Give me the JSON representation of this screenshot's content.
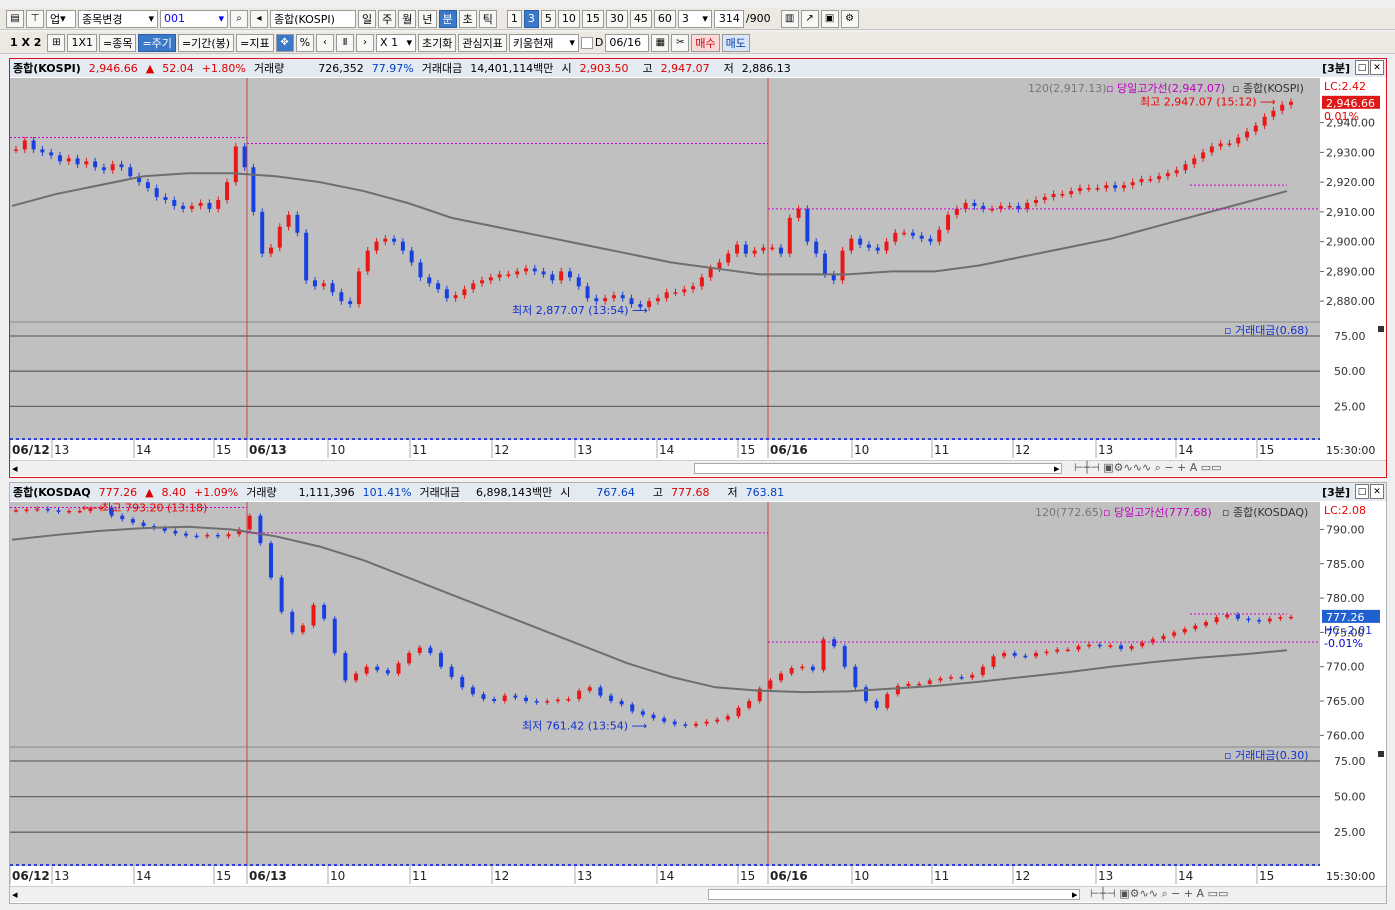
{
  "toolbar1": {
    "market": "업",
    "stock_change": "종목변경",
    "code": "001",
    "search_name": "종합(KOSPI)",
    "periods": [
      "일",
      "주",
      "월",
      "년",
      "분",
      "초",
      "틱"
    ],
    "active_period": "분",
    "intervals": [
      "1",
      "3",
      "5",
      "10",
      "15",
      "30",
      "45",
      "60"
    ],
    "active_interval": "3",
    "count_select": "3",
    "count": "314",
    "count_max": "/900"
  },
  "toolbar2": {
    "layout": "1 X 2",
    "btn_1x1": "1X1",
    "btn_stock": "=종목",
    "btn_period": "=주기",
    "btn_range": "=기간(봉)",
    "btn_indicator": "=지표",
    "btn_pct": "%",
    "zoom": "X 1",
    "btn_reset": "초기화",
    "btn_watch": "관심지표",
    "btn_kiwoom": "키움현재",
    "date": "06/16",
    "btn_buy": "매수",
    "btn_sell": "매도"
  },
  "panes": [
    {
      "title": "종합(KOSPI)",
      "price": "2,946.66",
      "arrow": "▲",
      "change": "52.04",
      "change_pct": "+1.80%",
      "vol_label": "거래량",
      "volume": "726,352",
      "vol_ratio": "77.97%",
      "amt_label": "거래대금",
      "amount": "14,401,114백만",
      "open_label": "시",
      "open": "2,903.50",
      "high_label": "고",
      "high": "2,947.07",
      "low_label": "저",
      "low": "2,886.13",
      "period_badge": "[3분]",
      "legend_ma": "120(2,917.13)",
      "legend_high": "당일고가선(2,947.07)",
      "legend_name": "종합(KOSPI)",
      "lc": "LC:2.42",
      "last_tag": "2,946.66",
      "hc": "0.01%",
      "max_label": "최고 2,947.07 (15:12)",
      "min_label": "최저 2,877.07 (13:54)",
      "sub_legend": "거래대금(0.68)",
      "time_label": "15:30:00"
    },
    {
      "title": "종합(KOSDAQ",
      "price": "777.26",
      "arrow": "▲",
      "change": "8.40",
      "change_pct": "+1.09%",
      "vol_label": "거래량",
      "volume": "1,111,396",
      "vol_ratio": "101.41%",
      "amt_label": "거래대금",
      "amount": "6,898,143백만",
      "open_label": "시",
      "open": "767.64",
      "high_label": "고",
      "high": "777.68",
      "low_label": "저",
      "low": "763.81",
      "period_badge": "[3분]",
      "legend_ma": "120(772.65)",
      "legend_high": "당일고가선(777.68)",
      "legend_name": "종합(KOSDAQ)",
      "lc": "LC:2.08",
      "last_tag": "777.26",
      "hc": "HC:-2.01",
      "hc2": "-0.01%",
      "max_label": "최고 793.20 (13:18)",
      "min_label": "최저 761.42 (13:54)",
      "sub_legend": "거래대금(0.30)",
      "time_label": "15:30:00"
    }
  ],
  "chart_data": [
    {
      "type": "candlestick",
      "series_name": "종합(KOSPI)",
      "x_ticks": [
        "06/12",
        "13",
        "14",
        "15",
        "06/13",
        "10",
        "11",
        "12",
        "13",
        "14",
        "15",
        "06/16",
        "10",
        "11",
        "12",
        "13",
        "14",
        "15"
      ],
      "y_ticks": [
        2940,
        2930,
        2920,
        2910,
        2900,
        2890,
        2880
      ],
      "ylim": [
        2873,
        2955
      ],
      "close_path": [
        2931,
        2934,
        2931,
        2930,
        2929,
        2927,
        2928,
        2926,
        2927,
        2925,
        2924,
        2926,
        2925,
        2922,
        2920,
        2918,
        2915,
        2914,
        2912,
        2911,
        2912,
        2913,
        2911,
        2914,
        2920,
        2932,
        2925,
        2910,
        2896,
        2898,
        2905,
        2909,
        2903,
        2887,
        2885,
        2886,
        2883,
        2880,
        2879,
        2890,
        2897,
        2900,
        2901,
        2900,
        2897,
        2893,
        2888,
        2886,
        2884,
        2881,
        2882,
        2884,
        2886,
        2887,
        2888,
        2889,
        2889,
        2890,
        2891,
        2890,
        2889,
        2887,
        2890,
        2888,
        2885,
        2881,
        2880,
        2881,
        2882,
        2881,
        2879,
        2878,
        2880,
        2881,
        2883,
        2883,
        2884,
        2885,
        2888,
        2891,
        2893,
        2896,
        2899,
        2896,
        2897,
        2898,
        2898,
        2896,
        2908,
        2911,
        2900,
        2896,
        2889,
        2887,
        2897,
        2901,
        2899,
        2898,
        2897,
        2900,
        2903,
        2903,
        2902,
        2901,
        2900,
        2904,
        2909,
        2911,
        2913,
        2912,
        2911,
        2911,
        2912,
        2912,
        2911,
        2913,
        2914,
        2915,
        2916,
        2916,
        2917,
        2918,
        2918,
        2918,
        2919,
        2918,
        2919,
        2920,
        2921,
        2921,
        2922,
        2923,
        2924,
        2926,
        2928,
        2930,
        2932,
        2933,
        2933,
        2935,
        2937,
        2939,
        2942,
        2944,
        2946,
        2947
      ],
      "ma120": [
        2912,
        2916,
        2919,
        2922,
        2923,
        2923,
        2922,
        2920,
        2917,
        2913,
        2908,
        2905,
        2902,
        2899,
        2896,
        2893,
        2891,
        2889,
        2889,
        2889,
        2890,
        2890,
        2892,
        2895,
        2898,
        2901,
        2905,
        2909,
        2913,
        2917
      ],
      "day_highs": [
        2935,
        2933,
        2911,
        2919
      ],
      "prev_close": 2894.62,
      "annotations": {
        "max": 2947.07,
        "min": 2877.07,
        "last": 2946.66
      },
      "sub": {
        "name": "거래대금",
        "y_ticks": [
          75,
          50,
          25
        ]
      }
    },
    {
      "type": "candlestick",
      "series_name": "종합(KOSDAQ)",
      "x_ticks": [
        "06/12",
        "13",
        "14",
        "15",
        "06/13",
        "10",
        "11",
        "12",
        "13",
        "14",
        "15",
        "06/16",
        "10",
        "11",
        "12",
        "13",
        "14",
        "15"
      ],
      "y_ticks": [
        790,
        785,
        780,
        775,
        770,
        765,
        760
      ],
      "ylim": [
        758.3,
        794
      ],
      "close_path": [
        792.8,
        792.9,
        793,
        792.8,
        792.6,
        792.7,
        792.7,
        793,
        793.2,
        792,
        791.5,
        791,
        790.5,
        790.2,
        789.8,
        789.4,
        789.1,
        789,
        789.2,
        789,
        789.3,
        790,
        792,
        788,
        783,
        778,
        775,
        776,
        779,
        777,
        772,
        768,
        769,
        770,
        769.5,
        769,
        770.5,
        772,
        772.8,
        772,
        770,
        768.5,
        767,
        766,
        765.3,
        765,
        765.8,
        765.5,
        765,
        764.8,
        765,
        765.2,
        765.3,
        766.5,
        767,
        765.8,
        765,
        764.5,
        763.5,
        763,
        762.5,
        762,
        761.6,
        761.4,
        761.7,
        762,
        762.3,
        762.8,
        764,
        765,
        766.8,
        768,
        769,
        769.8,
        770,
        769.5,
        774,
        773,
        770,
        767,
        765,
        764,
        766,
        767.2,
        767.5,
        767.5,
        768,
        768.3,
        768.5,
        768.4,
        768.8,
        770,
        771.5,
        772,
        771.6,
        771.5,
        772,
        772.2,
        772.5,
        772.5,
        773,
        773.2,
        773,
        773.1,
        772.6,
        773,
        773.5,
        774,
        774.5,
        775,
        775.5,
        776,
        776.5,
        777.2,
        777.6,
        777,
        776.8,
        776.6,
        777,
        777.2,
        777.26
      ],
      "ma120": [
        788.5,
        789.2,
        789.8,
        790.2,
        790.4,
        790,
        789,
        787.5,
        785.5,
        783,
        780.5,
        778,
        775.5,
        773,
        770.5,
        768.5,
        767,
        766.5,
        766.3,
        766.4,
        766.8,
        767.2,
        767.8,
        768.5,
        769.2,
        770,
        770.7,
        771.3,
        771.8,
        772.4
      ],
      "day_highs": [
        793.2,
        789.5,
        773.6,
        777.68
      ],
      "annotations": {
        "max": 793.2,
        "min": 761.42,
        "last": 777.26
      },
      "sub": {
        "name": "거래대금",
        "y_ticks": [
          75,
          50,
          25
        ]
      }
    }
  ]
}
